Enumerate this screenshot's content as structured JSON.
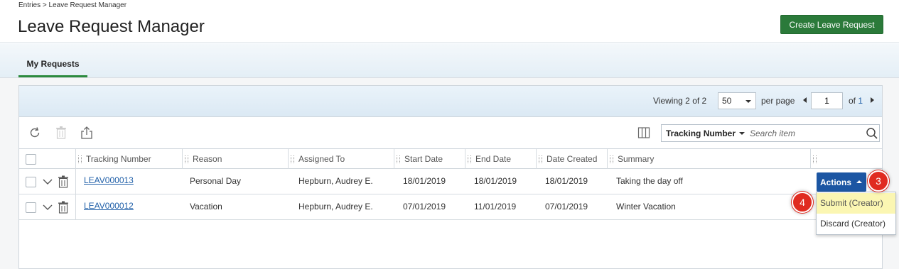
{
  "breadcrumb": "Entries > Leave Request Manager",
  "page_title": "Leave Request Manager",
  "create_button": "Create Leave Request",
  "tab": "My Requests",
  "pager": {
    "viewing_label": "Viewing",
    "viewing_count": "2",
    "of_word": "of",
    "total_count": "2",
    "per_page_value": "50",
    "per_page_label": "per page",
    "page_value": "1",
    "of_pages_label": "of",
    "total_pages": "1"
  },
  "search": {
    "field": "Tracking Number",
    "placeholder": "Search item"
  },
  "columns": [
    "Tracking Number",
    "Reason",
    "Assigned To",
    "Start Date",
    "End Date",
    "Date Created",
    "Summary"
  ],
  "rows": [
    {
      "tracking_number": "LEAV000013",
      "reason": "Personal Day",
      "assigned_to": "Hepburn, Audrey E.",
      "start_date": "18/01/2019",
      "end_date": "18/01/2019",
      "date_created": "18/01/2019",
      "summary": "Taking the day off"
    },
    {
      "tracking_number": "LEAV000012",
      "reason": "Vacation",
      "assigned_to": "Hepburn, Audrey E.",
      "start_date": "07/01/2019",
      "end_date": "11/01/2019",
      "date_created": "07/01/2019",
      "summary": "Winter Vacation"
    }
  ],
  "actions": {
    "label": "Actions",
    "items": [
      "Submit (Creator)",
      "Discard (Creator)"
    ]
  },
  "markers": [
    "3",
    "4"
  ],
  "colors": {
    "accent_green": "#2b7a3a",
    "actions_blue": "#1c56a3",
    "marker_red": "#e02b20",
    "highlight_yellow": "#fbf6b2"
  }
}
